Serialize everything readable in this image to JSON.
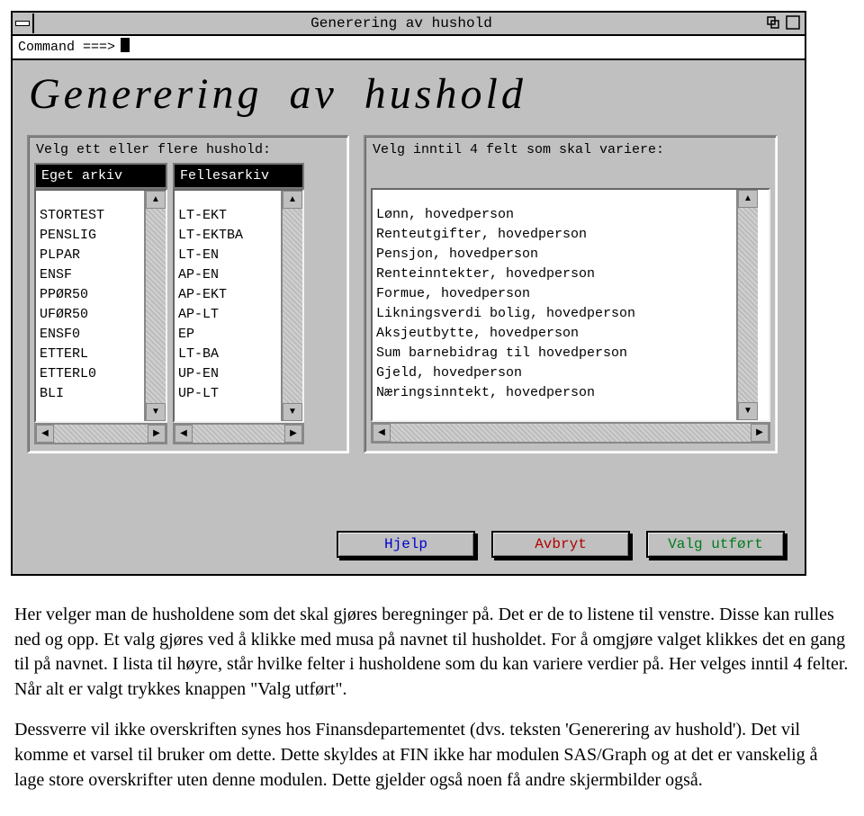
{
  "titlebar": {
    "title": "Generering av hushold"
  },
  "command": {
    "label": "Command ===>"
  },
  "heading": "Generering  av  hushold",
  "left_panel": {
    "label": "Velg ett eller flere hushold:",
    "col1_header": "Eget arkiv",
    "col2_header": "Fellesarkiv",
    "col1_items": [
      "STORTEST",
      "PENSLIG",
      "PLPAR",
      "ENSF",
      "PPØR50",
      "UFØR50",
      "ENSF0",
      "ETTERL",
      "ETTERL0",
      "BLI"
    ],
    "col2_items": [
      "LT-EKT",
      "LT-EKTBA",
      "LT-EN",
      "AP-EN",
      "AP-EKT",
      "AP-LT",
      "EP",
      "LT-BA",
      "UP-EN",
      "UP-LT"
    ]
  },
  "right_panel": {
    "label": "Velg inntil 4 felt som skal variere:",
    "items": [
      "Lønn, hovedperson",
      "Renteutgifter, hovedperson",
      "Pensjon, hovedperson",
      "Renteinntekter, hovedperson",
      "Formue, hovedperson",
      "Likningsverdi bolig, hovedperson",
      "Aksjeutbytte, hovedperson",
      "Sum barnebidrag til hovedperson",
      "Gjeld, hovedperson",
      "Næringsinntekt, hovedperson"
    ]
  },
  "buttons": {
    "help": "Hjelp",
    "cancel": "Avbryt",
    "done": "Valg utført"
  },
  "bodytext": {
    "p1": "Her velger man de husholdene som det skal gjøres beregninger på. Det er de to listene til venstre. Disse kan rulles ned og opp. Et valg gjøres ved å klikke med musa på navnet til husholdet. For å omgjøre valget klikkes det en gang til på  navnet.  I lista til høyre, står hvilke felter i husholdene som du kan variere verdier på. Her velges inntil 4 felter. Når alt er valgt trykkes knappen \"Valg utført\".",
    "p2": "Dessverre vil ikke overskriften synes hos Finansdepartementet (dvs. teksten 'Generering av hushold'). Det vil komme et varsel til bruker om dette. Dette skyldes at FIN ikke har modulen SAS/Graph og at det er vanskelig å lage store overskrifter uten denne modulen. Dette gjelder også noen få andre skjermbilder også."
  }
}
